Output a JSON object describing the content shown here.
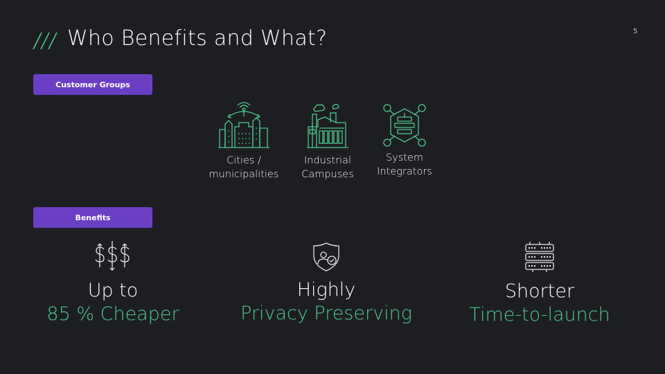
{
  "slide": {
    "title": "Who Benefits and What?",
    "page_number": "5",
    "accent_color": "#4ec98f",
    "pill_color": "#6b3fc4"
  },
  "customer_groups": {
    "label": "Customer Groups",
    "items": [
      {
        "icon": "smart-city-icon",
        "label_line1": "Cities /",
        "label_line2": "municipalities"
      },
      {
        "icon": "factory-icon",
        "label_line1": "Industrial",
        "label_line2": "Campuses"
      },
      {
        "icon": "system-integration-icon",
        "label_line1": "System",
        "label_line2": "Integrators"
      }
    ]
  },
  "benefits": {
    "label": "Benefits",
    "items": [
      {
        "icon": "dollar-signs-icon",
        "top": "Up to",
        "bottom": "85 % Cheaper"
      },
      {
        "icon": "privacy-shield-icon",
        "top": "Highly",
        "bottom": "Privacy Preserving"
      },
      {
        "icon": "server-rack-icon",
        "top": "Shorter",
        "bottom": "Time-to-launch"
      }
    ]
  }
}
